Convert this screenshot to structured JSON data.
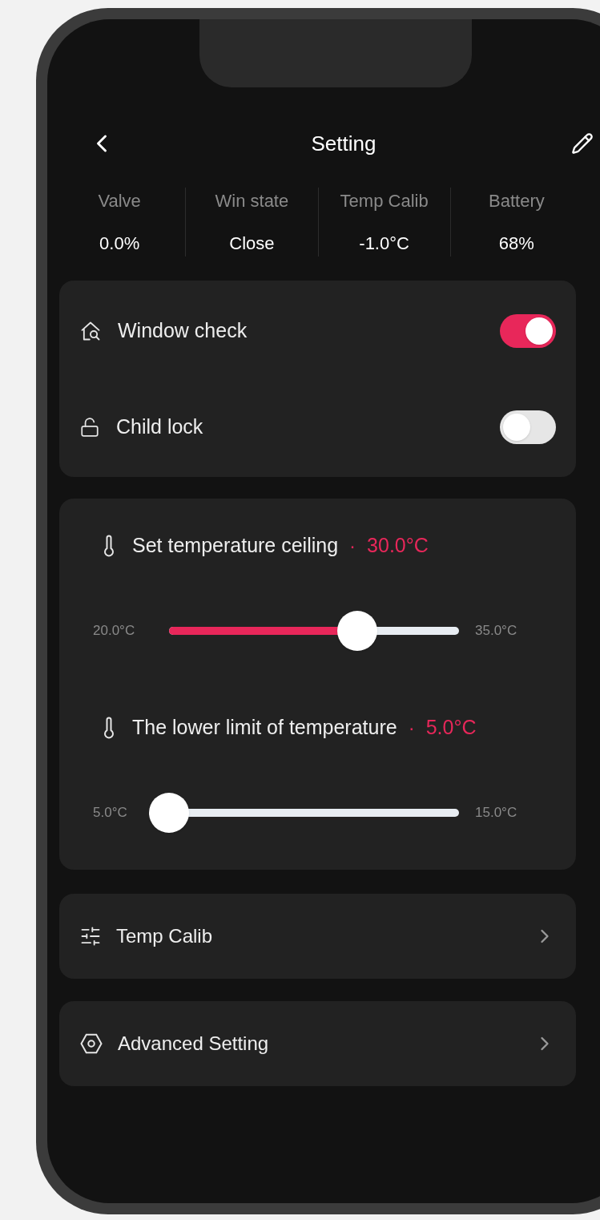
{
  "header": {
    "title": "Setting"
  },
  "stats": [
    {
      "label": "Valve",
      "value": "0.0%"
    },
    {
      "label": "Win state",
      "value": "Close"
    },
    {
      "label": "Temp Calib",
      "value": "-1.0°C"
    },
    {
      "label": "Battery",
      "value": "68%"
    }
  ],
  "toggles": [
    {
      "kind": "window",
      "label": "Window check",
      "on": true
    },
    {
      "kind": "lock",
      "label": "Child lock",
      "on": false
    }
  ],
  "sliders": [
    {
      "label": "Set temperature ceiling",
      "separator": "·",
      "value": "30.0°C",
      "min": "20.0°C",
      "max": "35.0°C",
      "level": 0.65
    },
    {
      "label": "The lower limit of temperature",
      "separator": "·",
      "value": "5.0°C",
      "min": "5.0°C",
      "max": "15.0°C",
      "level": 0
    }
  ],
  "menu": [
    {
      "kind": "sliders",
      "label": "Temp Calib"
    },
    {
      "kind": "hexagon",
      "label": "Advanced Setting"
    }
  ]
}
